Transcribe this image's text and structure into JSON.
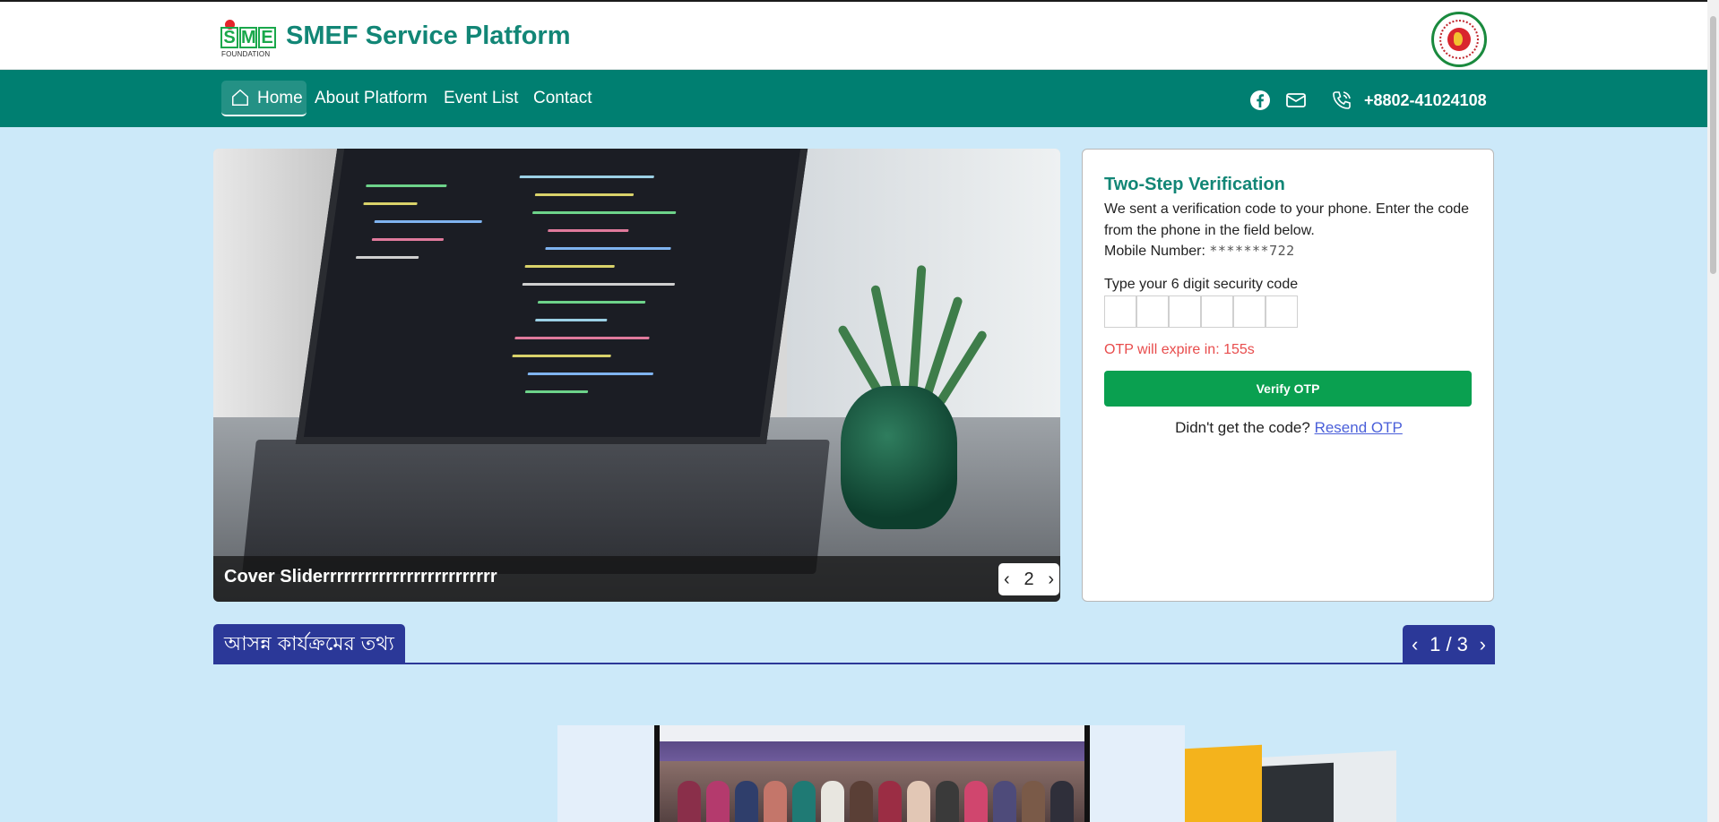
{
  "header": {
    "logo_letters": [
      "S",
      "M",
      "E"
    ],
    "logo_sub": "FOUNDATION",
    "brand_title": "SMEF Service Platform"
  },
  "nav": {
    "items": [
      {
        "label": "Home"
      },
      {
        "label": "About Platform"
      },
      {
        "label": "Event List"
      },
      {
        "label": "Contact"
      }
    ],
    "phone": "+8802-41024108"
  },
  "slider": {
    "caption": "Cover Sliderrrrrrrrrrrrrrrrrrrrrrrrr",
    "current": "2",
    "prev": "‹",
    "next": "›"
  },
  "otp": {
    "title": "Two-Step Verification",
    "description": "We sent a verification code to your phone. Enter the code from the phone in the field below.",
    "mobile_label": "Mobile Number: ",
    "mobile_masked": "*******722",
    "code_label": "Type your 6 digit security code",
    "expire_text": "OTP will expire in: 155s",
    "verify_button": "Verify OTP",
    "resend_prompt": "Didn't get the code? ",
    "resend_link": "Resend OTP"
  },
  "events_section": {
    "title": "আসন্ন কার্যক্রমের তথ্য",
    "page": "1 / 3",
    "prev": "‹",
    "next": "›"
  },
  "colors": {
    "brand_teal": "#007f71",
    "page_bg": "#cce9f9",
    "verify_green": "#0aa050",
    "section_blue": "#2b3898",
    "expire_red": "#e84c4c"
  }
}
